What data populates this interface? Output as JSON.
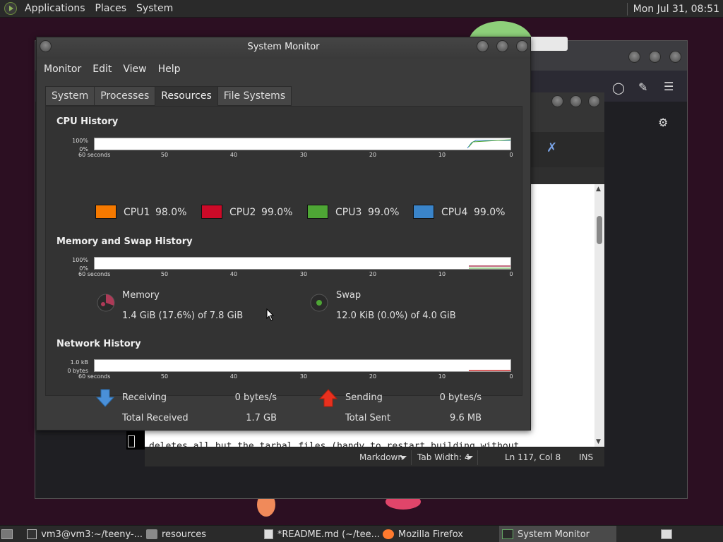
{
  "top_panel": {
    "menus": [
      "Applications",
      "Places",
      "System"
    ],
    "clock": "Mon Jul 31, 08:51"
  },
  "editor": {
    "visible_line": "deletes all but the tarbal files (handy to restart building without",
    "status": {
      "language": "Markdown",
      "tab_width": "Tab Width:  4",
      "position": "Ln 117, Col 8",
      "mode": "INS"
    }
  },
  "system_monitor": {
    "title": "System Monitor",
    "menus": [
      "Monitor",
      "Edit",
      "View",
      "Help"
    ],
    "tabs": [
      "System",
      "Processes",
      "Resources",
      "File Systems"
    ],
    "active_tab": "Resources",
    "graph_ticks": [
      "60 seconds",
      "50",
      "40",
      "30",
      "20",
      "10",
      "0"
    ],
    "cpu": {
      "title": "CPU History",
      "scale_top": "100%",
      "scale_bottom": "0%",
      "cores": [
        {
          "name": "CPU1",
          "value": "98.0%",
          "color": "#f57900"
        },
        {
          "name": "CPU2",
          "value": "99.0%",
          "color": "#cc0a28"
        },
        {
          "name": "CPU3",
          "value": "99.0%",
          "color": "#4ea635"
        },
        {
          "name": "CPU4",
          "value": "99.0%",
          "color": "#3a84c9"
        }
      ]
    },
    "memory": {
      "title": "Memory and Swap History",
      "scale_top": "100%",
      "scale_bottom": "0%",
      "memory_label": "Memory",
      "memory_value": "1.4 GiB (17.6%) of 7.8 GiB",
      "swap_label": "Swap",
      "swap_value": "12.0 KiB (0.0%) of 4.0 GiB",
      "memory_color": "#ad3a57",
      "swap_color": "#4ea635"
    },
    "network": {
      "title": "Network History",
      "scale_top": "1.0 kB",
      "scale_bottom": "0 bytes",
      "receiving_label": "Receiving",
      "receiving_value": "0 bytes/s",
      "total_received_label": "Total Received",
      "total_received_value": "1.7 GB",
      "sending_label": "Sending",
      "sending_value": "0 bytes/s",
      "total_sent_label": "Total Sent",
      "total_sent_value": "9.6 MB"
    }
  },
  "taskbar": {
    "tasks": [
      {
        "label": "vm3@vm3:~/teeny-...",
        "icon": "terminal-icon"
      },
      {
        "label": "resources",
        "icon": "folder-icon"
      },
      {
        "label": "*README.md (~/tee...",
        "icon": "text-editor-icon"
      },
      {
        "label": "Mozilla Firefox",
        "icon": "firefox-icon"
      },
      {
        "label": "System Monitor",
        "icon": "system-monitor-icon",
        "active": true
      }
    ]
  }
}
